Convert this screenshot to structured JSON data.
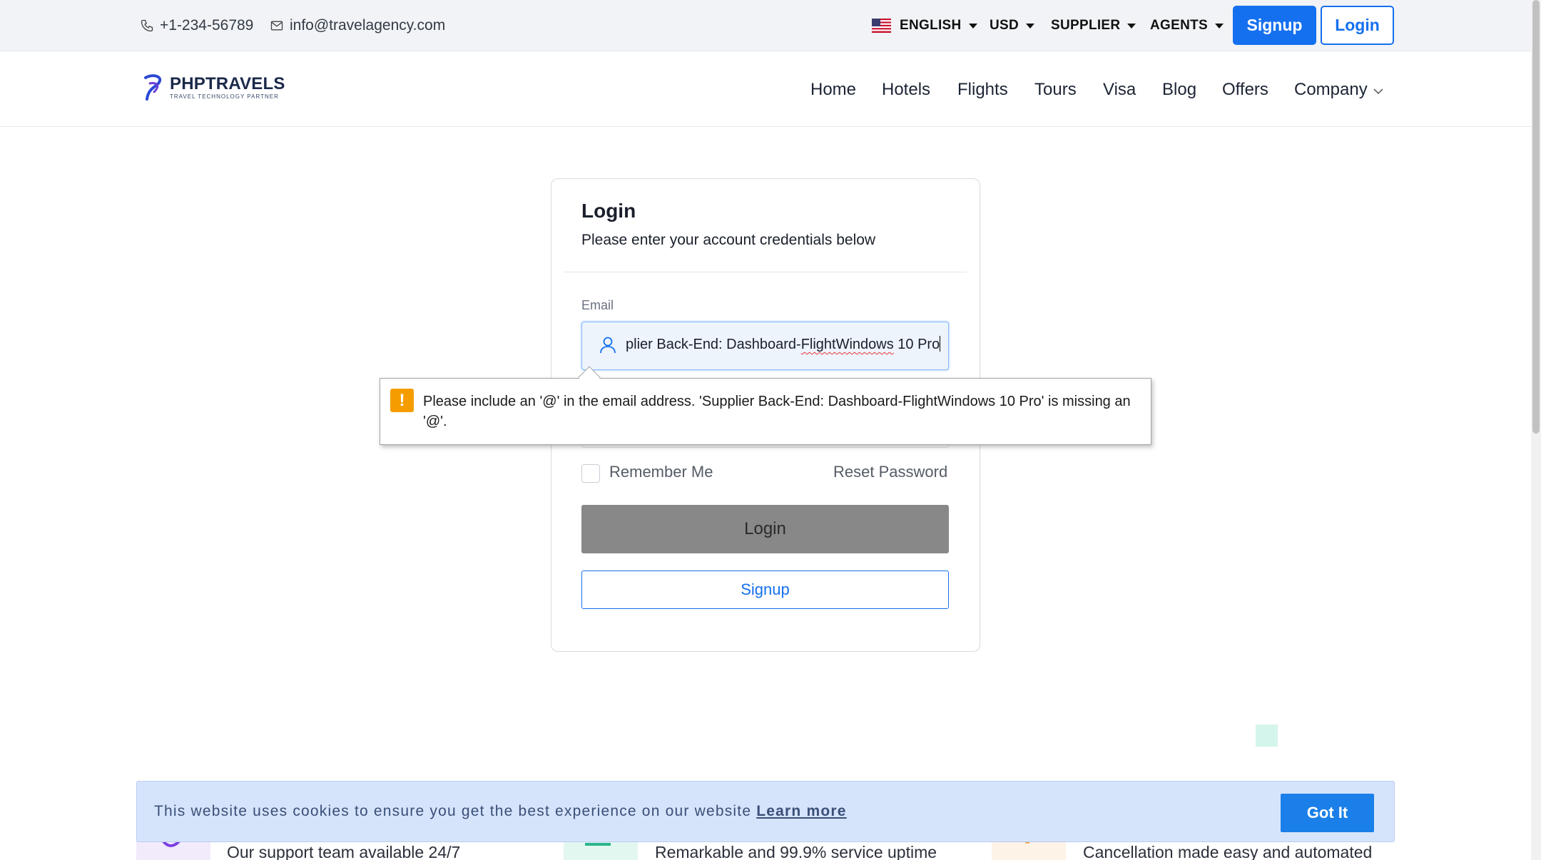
{
  "topbar": {
    "phone": "+1-234-56789",
    "email": "info@travelagency.com",
    "language": "ENGLISH",
    "currency": "USD",
    "supplier": "SUPPLIER",
    "agents": "AGENTS",
    "signup": "Signup",
    "login": "Login"
  },
  "navbar": {
    "logo_name": "PHPTRAVELS",
    "logo_tagline": "TRAVEL TECHNOLOGY PARTNER",
    "links": [
      "Home",
      "Hotels",
      "Flights",
      "Tours",
      "Visa",
      "Blog",
      "Offers",
      "Company"
    ]
  },
  "login_card": {
    "title": "Login",
    "subtitle": "Please enter your account credentials below",
    "email_label": "Email",
    "email_value_pre": "plier Back-End: Dashboard-",
    "email_value_misspelled": "FlightWindows",
    "email_value_post": " 10 Pro",
    "remember_me": "Remember Me",
    "reset_password": "Reset Password",
    "login_button": "Login",
    "signup_button": "Signup"
  },
  "validation_tooltip": {
    "icon": "!",
    "message": "Please include an '@' in the email address. 'Supplier Back-End: Dashboard-FlightWindows 10 Pro' is missing an '@'."
  },
  "features": [
    "Our support team available 24/7",
    "Remarkable and 99.9% service uptime",
    "Cancellation made easy and automated"
  ],
  "cookie_bar": {
    "text": "This website uses cookies to ensure you get the best experience on our website",
    "learn_more": "Learn more",
    "button": "Got It"
  },
  "colors": {
    "primary": "#1570ef",
    "login_button_bg": "#888888",
    "cookie_bg": "#d6e4fb",
    "warning_icon": "#f59d00"
  }
}
